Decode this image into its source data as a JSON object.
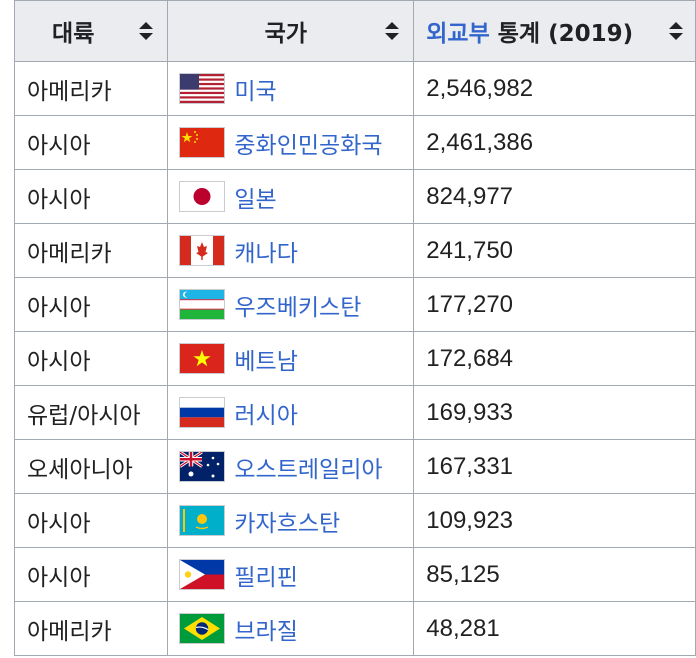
{
  "table": {
    "headers": {
      "continent": "대륙",
      "country": "국가",
      "stats_link": "외교부",
      "stats_rest": " 통계 (2019)"
    },
    "rows": [
      {
        "continent": "아메리카",
        "country": "미국",
        "flag": "usa-flag-icon",
        "value": "2,546,982"
      },
      {
        "continent": "아시아",
        "country": "중화인민공화국",
        "flag": "china-flag-icon",
        "value": "2,461,386"
      },
      {
        "continent": "아시아",
        "country": "일본",
        "flag": "japan-flag-icon",
        "value": "824,977"
      },
      {
        "continent": "아메리카",
        "country": "캐나다",
        "flag": "canada-flag-icon",
        "value": "241,750"
      },
      {
        "continent": "아시아",
        "country": "우즈베키스탄",
        "flag": "uzbekistan-flag-icon",
        "value": "177,270"
      },
      {
        "continent": "아시아",
        "country": "베트남",
        "flag": "vietnam-flag-icon",
        "value": "172,684"
      },
      {
        "continent": "유럽/아시아",
        "country": "러시아",
        "flag": "russia-flag-icon",
        "value": "169,933"
      },
      {
        "continent": "오세아니아",
        "country": "오스트레일리아",
        "flag": "australia-flag-icon",
        "value": "167,331"
      },
      {
        "continent": "아시아",
        "country": "카자흐스탄",
        "flag": "kazakhstan-flag-icon",
        "value": "109,923"
      },
      {
        "continent": "아시아",
        "country": "필리핀",
        "flag": "philippines-flag-icon",
        "value": "85,125"
      },
      {
        "continent": "아메리카",
        "country": "브라질",
        "flag": "brazil-flag-icon",
        "value": "48,281"
      }
    ]
  },
  "colors": {
    "link": "#3366cc",
    "header_bg": "#eaecf0",
    "border": "#a2a9b1"
  }
}
